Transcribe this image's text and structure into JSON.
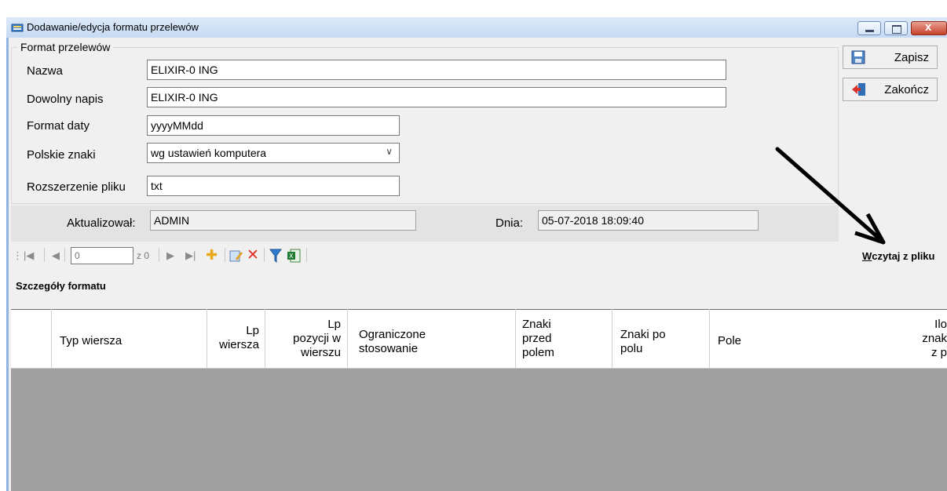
{
  "window": {
    "title": "Dodawanie/edycja formatu przelewów"
  },
  "group": {
    "legend": "Format przelewów"
  },
  "form": {
    "nazwa_label": "Nazwa",
    "nazwa_value": "ELIXIR-0 ING",
    "napis_label": "Dowolny napis",
    "napis_value": "ELIXIR-0 ING",
    "data_label": "Format daty",
    "data_value": "yyyyMMdd",
    "znaki_label": "Polskie znaki",
    "znaki_value": "wg ustawień komputera",
    "ext_label": "Rozszerzenie pliku",
    "ext_value": "txt"
  },
  "info": {
    "aktualizowal_label": "Aktualizował:",
    "aktualizowal_value": "ADMIN",
    "dnia_label": "Dnia:",
    "dnia_value": "05-07-2018 18:09:40"
  },
  "actions": {
    "zapisz": "Zapisz",
    "zakoncz": "Zakończ"
  },
  "navigator": {
    "position": "0",
    "count": "z 0",
    "load_prefix": "W",
    "load_rest": "czytaj z pliku"
  },
  "details": {
    "title": "Szczegóły formatu"
  },
  "columns": [
    "Typ wiersza",
    "Lp\nwiersza",
    "Lp\npozycji w\nwierszu",
    "Ograniczone\nstosowanie",
    "Znaki\nprzed\npolem",
    "Znaki po\npolu",
    "Pole",
    "Ilo\nznak\nz p"
  ],
  "colors": {
    "grid_bg": "#a0a0a0",
    "titlebar": "#c5daf3",
    "close_button": "#c6402a"
  }
}
